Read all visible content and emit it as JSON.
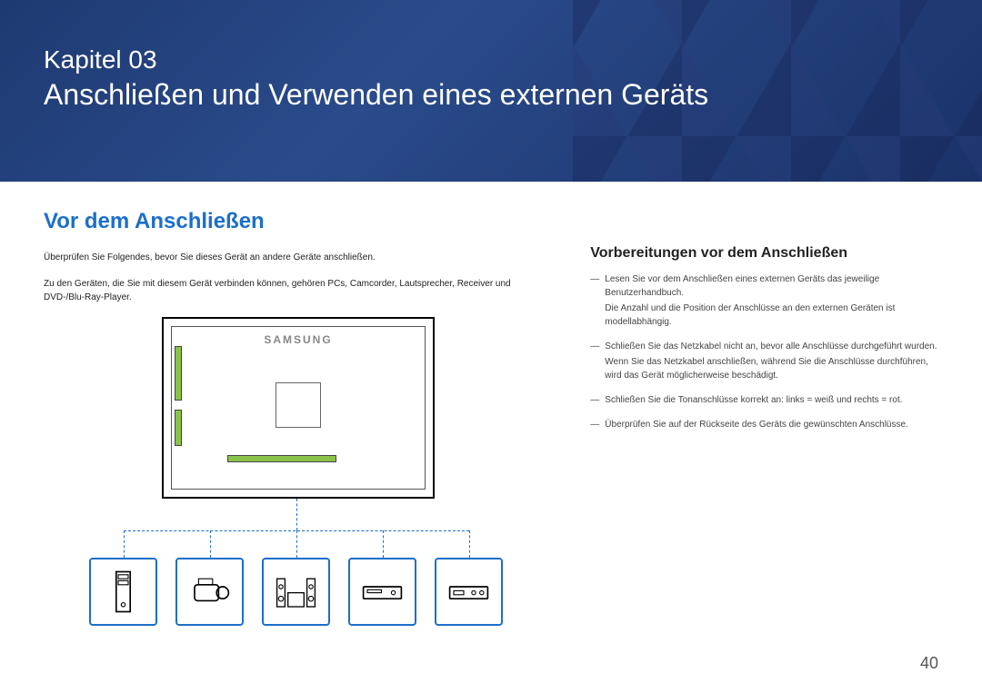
{
  "header": {
    "chapter_label": "Kapitel 03",
    "chapter_title": "Anschließen und Verwenden eines externen Geräts"
  },
  "section": {
    "title": "Vor dem Anschließen",
    "intro1": "Überprüfen Sie Folgendes, bevor Sie dieses Gerät an andere Geräte anschließen.",
    "intro2": "Zu den Geräten, die Sie mit diesem Gerät verbinden können, gehören PCs, Camcorder, Lautsprecher, Receiver und DVD-/Blu-Ray-Player."
  },
  "subsection": {
    "title": "Vorbereitungen vor dem Anschließen",
    "bullets": [
      {
        "main": "Lesen Sie vor dem Anschließen eines externen Geräts das jeweilige Benutzerhandbuch.",
        "sub": "Die Anzahl und die Position der Anschlüsse an den externen Geräten ist modellabhängig."
      },
      {
        "main": "Schließen Sie das Netzkabel nicht an, bevor alle Anschlüsse durchgeführt wurden.",
        "sub": "Wenn Sie das Netzkabel anschließen, während Sie die Anschlüsse durchführen, wird das Gerät möglicherweise beschädigt."
      },
      {
        "main": "Schließen Sie die Tonanschlüsse korrekt an: links = weiß und rechts = rot.",
        "sub": ""
      },
      {
        "main": "Überprüfen Sie auf der Rückseite des Geräts die gewünschten Anschlüsse.",
        "sub": ""
      }
    ]
  },
  "diagram": {
    "brand_label": "SAMSUNG",
    "devices": [
      "pc-tower",
      "camcorder",
      "speaker-system",
      "dvd-player",
      "receiver"
    ]
  },
  "page_number": "40"
}
